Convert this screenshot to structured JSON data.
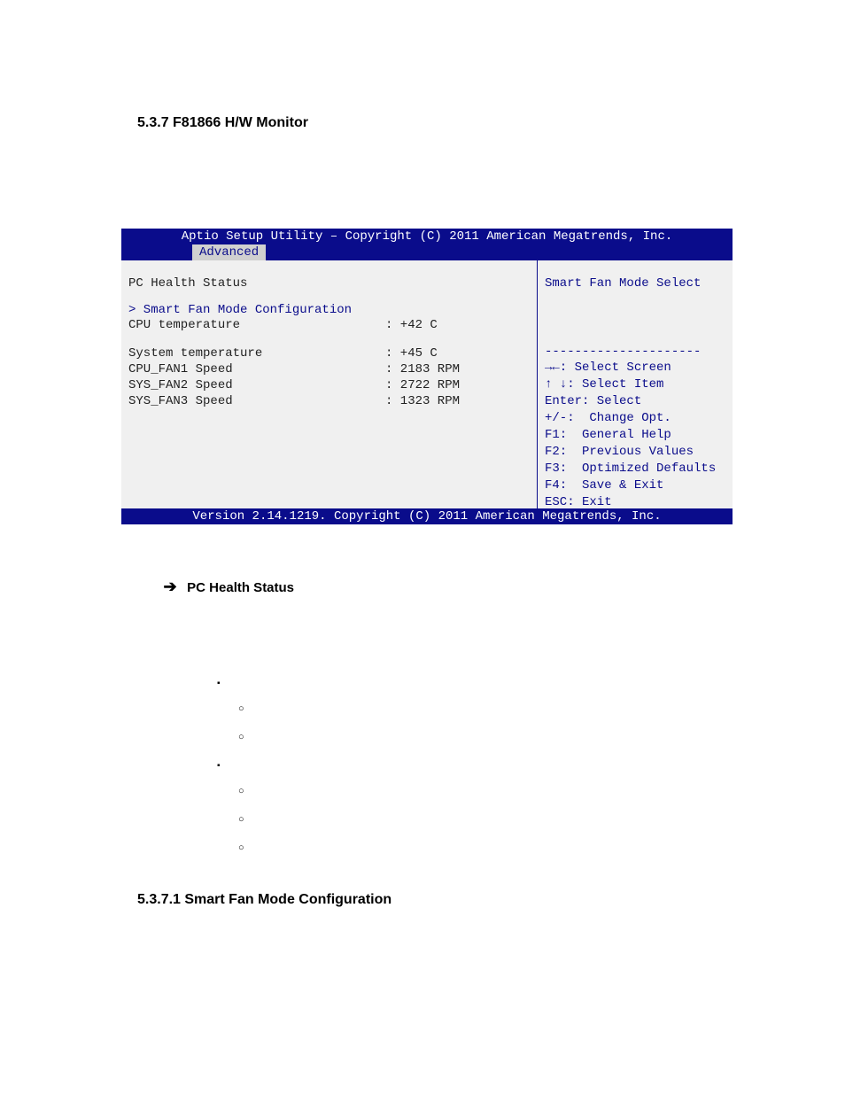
{
  "heading1": "5.3.7 F81866 H/W Monitor",
  "bios": {
    "header": "Aptio Setup Utility – Copyright (C) 2011 American Megatrends, Inc.",
    "tab": "Advanced",
    "pc_health": "PC Health Status",
    "smart_fan": "> Smart Fan Mode Configuration",
    "rows": [
      {
        "label": "CPU temperature",
        "value": ": +42 C"
      },
      {
        "label": "",
        "value": ""
      },
      {
        "label": "System temperature",
        "value": ": +45 C"
      },
      {
        "label": "CPU_FAN1 Speed",
        "value": ": 2183 RPM"
      },
      {
        "label": "SYS_FAN2 Speed",
        "value": ": 2722 RPM"
      },
      {
        "label": "SYS_FAN3 Speed",
        "value": ": 1323 RPM"
      }
    ],
    "help_title": "Smart Fan Mode Select",
    "help_divider": "---------------------",
    "help_lines": [
      "→←: Select Screen",
      "↑ ↓: Select Item",
      "Enter: Select",
      "+/-:  Change Opt.",
      "F1:  General Help",
      "F2:  Previous Values",
      "F3:  Optimized Defaults",
      "F4:  Save & Exit",
      "ESC: Exit"
    ],
    "footer": "Version 2.14.1219. Copyright (C) 2011 American Megatrends, Inc."
  },
  "pc_health_bullet": "PC Health Status",
  "heading2": "5.3.7.1 Smart Fan Mode Configuration"
}
